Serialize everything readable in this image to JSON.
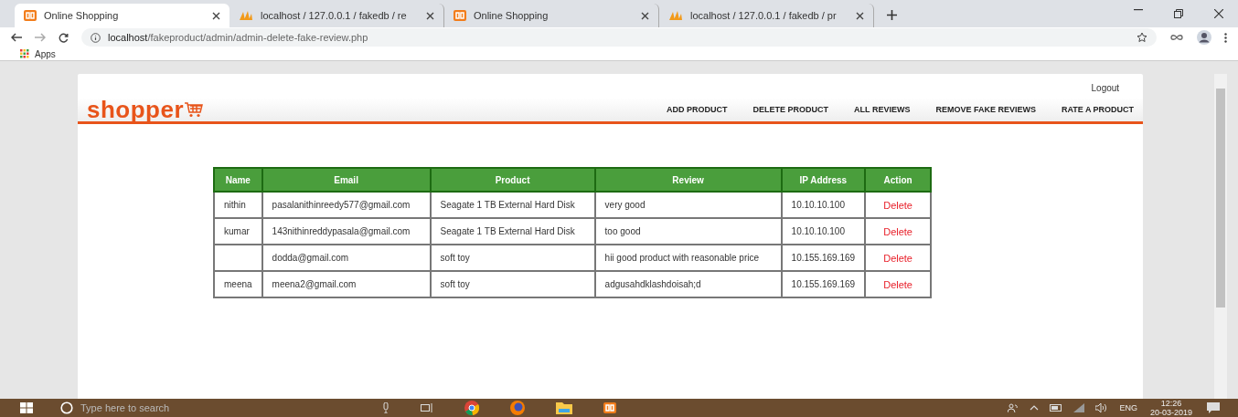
{
  "browser": {
    "tabs": [
      {
        "title": "Online Shopping",
        "kind": "shop",
        "selected": true
      },
      {
        "title": "localhost / 127.0.0.1 / fakedb / re",
        "kind": "database",
        "selected": false
      },
      {
        "title": "Online Shopping",
        "kind": "shop",
        "selected": false
      },
      {
        "title": "localhost / 127.0.0.1 / fakedb / pr",
        "kind": "database",
        "selected": false
      }
    ],
    "url": "**localhost**/fakeproduct/admin/admin-delete-fake-review.php",
    "bookmarks": [
      "Apps"
    ]
  },
  "site": {
    "logout": "Logout",
    "logo": "shopper",
    "nav": [
      "ADD PRODUCT",
      "DELETE PRODUCT",
      "ALL REVIEWS",
      "REMOVE FAKE REVIEWS",
      "RATE A PRODUCT"
    ]
  },
  "table": {
    "columns": [
      "Name",
      "Email",
      "Product",
      "Review",
      "IP Address",
      "Action"
    ],
    "rows": [
      [
        "nithin",
        "pasalanithinreedy577@gmail.com",
        "Seagate 1 TB External Hard Disk",
        "very good",
        "10.10.10.100",
        "Delete"
      ],
      [
        "kumar",
        "143nithinreddypasala@gmail.com",
        "Seagate 1 TB External Hard Disk",
        "too good",
        "10.10.10.100",
        "Delete"
      ],
      [
        "",
        "dodda@gmail.com",
        "soft toy",
        "hii good product with reasonable price",
        "10.155.169.169",
        "Delete"
      ],
      [
        "meena",
        "meena2@gmail.com",
        "soft toy",
        "adgusahdklashdoisah;d",
        "10.155.169.169",
        "Delete"
      ]
    ]
  },
  "taskbar": {
    "search_placeholder": "Type here to search",
    "language": "ENG",
    "time": "12:26",
    "date": "20-03-2019"
  }
}
